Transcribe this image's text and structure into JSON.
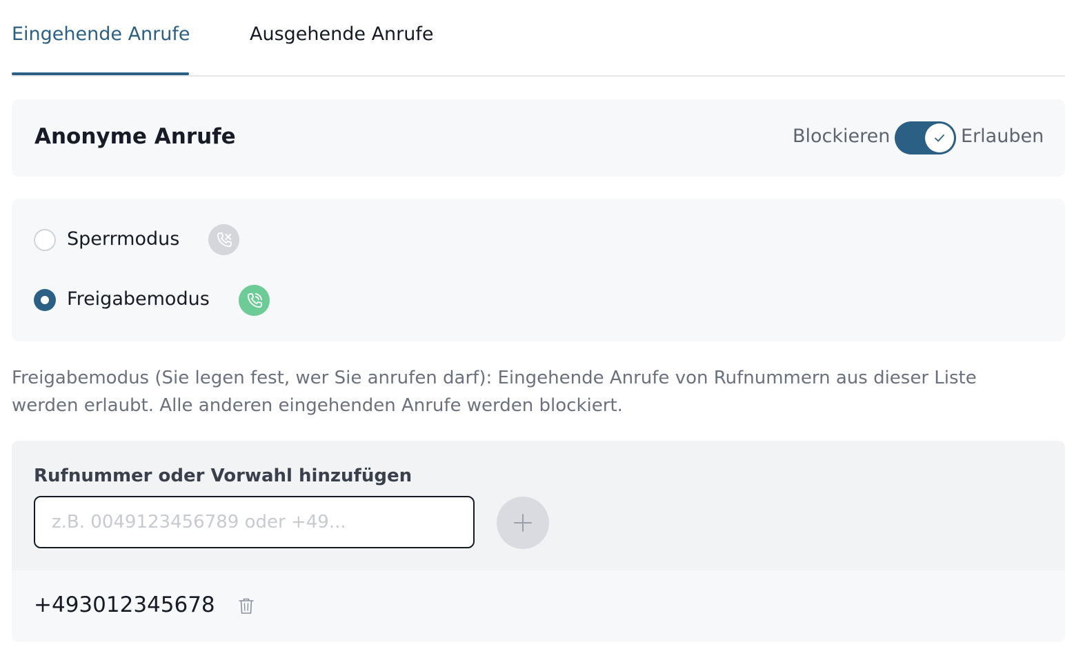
{
  "tabs": [
    {
      "label": "Eingehende Anrufe",
      "active": true
    },
    {
      "label": "Ausgehende Anrufe",
      "active": false
    }
  ],
  "anonymous": {
    "title": "Anonyme Anrufe",
    "toggle_off_label": "Blockieren",
    "toggle_on_label": "Erlauben",
    "allowed": true
  },
  "modes": [
    {
      "label": "Sperrmodus",
      "selected": false,
      "icon": "phone-blocked-icon"
    },
    {
      "label": "Freigabemodus",
      "selected": true,
      "icon": "phone-ringing-icon"
    }
  ],
  "description": "Freigabemodus (Sie legen fest, wer Sie anrufen darf): Eingehende Anrufe von Rufnummern aus dieser Liste werden erlaubt. Alle anderen eingehenden Anrufe werden blockiert.",
  "add": {
    "label": "Rufnummer oder Vorwahl hinzufügen",
    "value": "",
    "placeholder": "z.B. 0049123456789 oder +49...",
    "button_icon": "plus-icon"
  },
  "numbers": [
    {
      "number": "+493012345678",
      "action_icon": "trash-icon"
    }
  ],
  "colors": {
    "accent": "#2b5f83",
    "success": "#6dcc96",
    "muted": "#d4d6db",
    "card_bg": "#f7f8fa"
  }
}
